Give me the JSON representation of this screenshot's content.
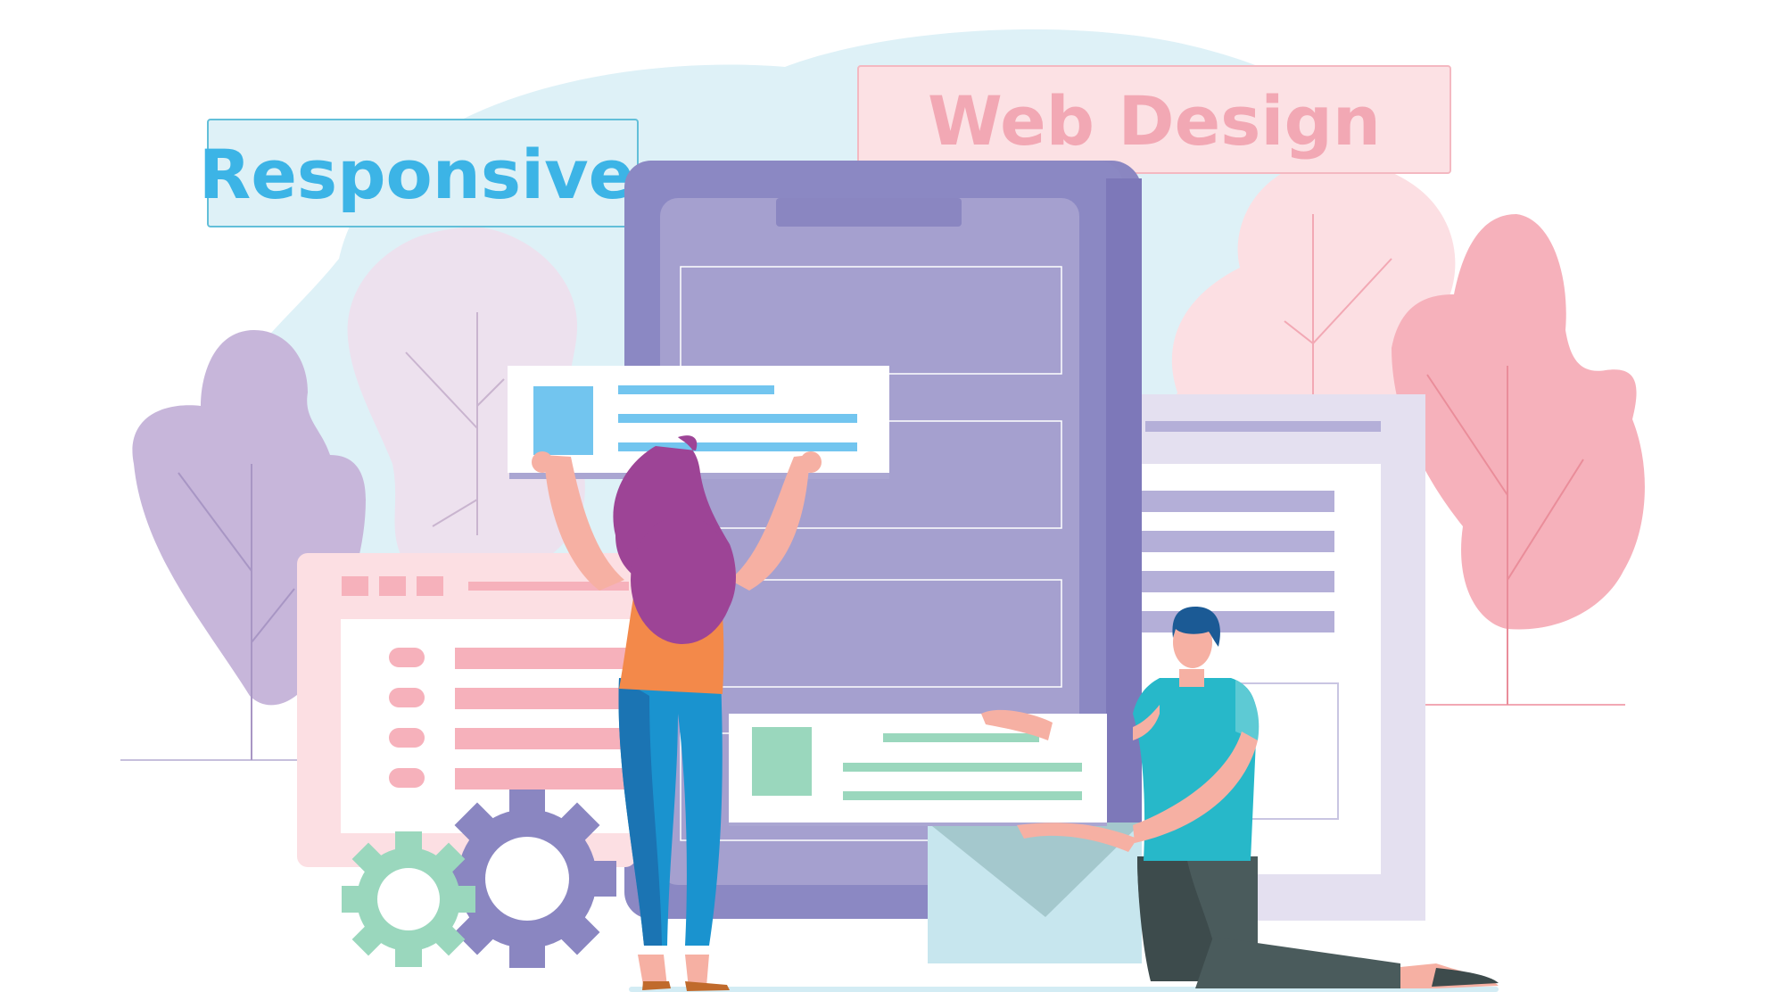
{
  "labels": {
    "responsive": "Responsive",
    "web_design": "Web Design"
  },
  "colors": {
    "responsive_text": "#3cb4e6",
    "responsive_box_fill": "#def1f7",
    "responsive_box_stroke": "#62bfd9",
    "web_design_text": "#f2a8b4",
    "web_design_box_fill": "#fce1e4",
    "web_design_box_stroke": "#f4b8c1",
    "phone_body": "#8a86c1",
    "phone_screen": "#a5a0cf",
    "background_blob": "#def1f7",
    "woman_hair": "#9d4496",
    "woman_top": "#f3894a",
    "woman_jeans": "#1a93cf",
    "man_shirt": "#27b8c9",
    "man_pants": "#4a5b5c",
    "man_hair": "#1b5a95"
  },
  "icons": [
    "gear-icon",
    "gear-icon",
    "envelope-icon",
    "image-placeholder-icon"
  ]
}
